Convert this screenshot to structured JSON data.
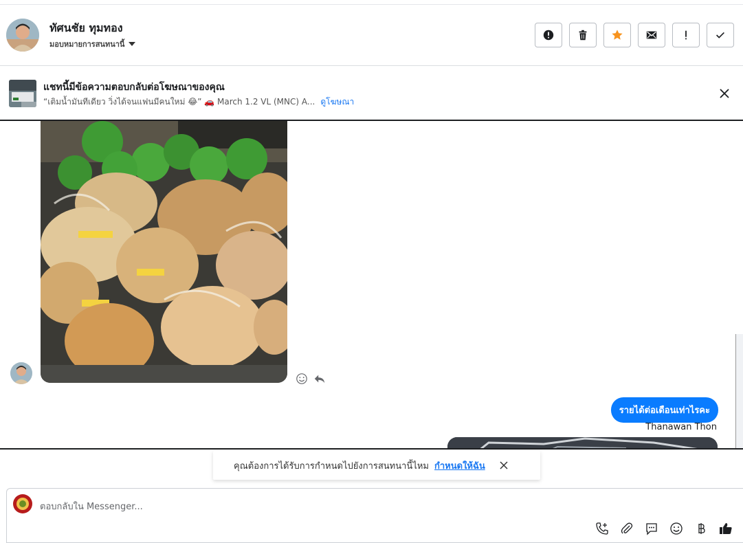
{
  "contact": {
    "name": "ทัศนชัย ทุมทอง",
    "assign_label": "มอบหมายการสนทนานี้"
  },
  "header_actions": [
    {
      "name": "spam-button",
      "icon": "alert-circle-icon"
    },
    {
      "name": "delete-button",
      "icon": "trash-icon"
    },
    {
      "name": "star-button",
      "icon": "star-icon",
      "color": "#f7931e"
    },
    {
      "name": "mark-unread-button",
      "icon": "envelope-icon"
    },
    {
      "name": "flag-button",
      "icon": "exclamation-icon"
    },
    {
      "name": "done-button",
      "icon": "check-icon"
    }
  ],
  "ad_banner": {
    "title": "แชทนี้มีข้อความตอบกลับต่อโฆษณาของคุณ",
    "subtitle": "“เติมน้ำมันทีเดียว วิ่งได้จนแฟนมีคนใหม่ 😂” 🚗 March 1.2 VL (MNC) A...",
    "link": "ดูโฆษณา"
  },
  "messages": {
    "outgoing_text": "รายได้ต่อเดือนเท่าไรคะ",
    "outgoing_sender": "Thanawan Thon"
  },
  "toast": {
    "text": "คุณต้องการได้รับการกำหนดไปยังการสนทนานี้ไหม",
    "link": "กำหนดให้ฉัน"
  },
  "composer": {
    "placeholder": "ตอบกลับใน Messenger...",
    "tools": [
      "call-plus-icon",
      "paperclip-icon",
      "saved-reply-icon",
      "emoji-icon",
      "baht-icon",
      "thumbs-up-icon"
    ]
  },
  "colors": {
    "accent": "#0a7cff",
    "link": "#1877f2",
    "star": "#f7931e"
  }
}
